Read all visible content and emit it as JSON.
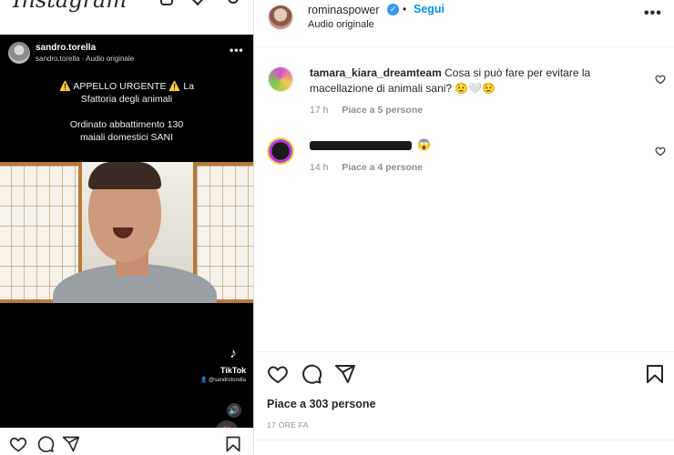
{
  "brand": {
    "name": "Instagram"
  },
  "video": {
    "username": "sandro.torella",
    "subline": "sandro.torella · Audio originale",
    "text_line1": "⚠️ APPELLO URGENTE ⚠️ La",
    "text_line2": "Sfattoria degli animali",
    "text_line3": "Ordinato abbattimento 130",
    "text_line4": "maiali domestici SANI",
    "tiktok_logo": "♪",
    "tiktok_label": "TikTok",
    "tiktok_handle": "👤 @sandrotorella",
    "more_icon": "•••",
    "sound_icon": "🔊",
    "mute_icon": "🔇"
  },
  "post": {
    "author": "rominaspower",
    "verified_mark": "✓",
    "separator": "•",
    "follow": "Segui",
    "audio": "Audio originale",
    "more_icon": "•••"
  },
  "comments": [
    {
      "username": "tamara_kiara_dreamteam",
      "text": "Cosa si può fare per evitare la macellazione di animali sani? 😟🤍😟",
      "time": "17 h",
      "likes": "Piace a 5 persone"
    },
    {
      "username": "",
      "text": "😱",
      "time": "14 h",
      "likes": "Piace a 4 persone"
    }
  ],
  "footer": {
    "likes": "Piace a 303 persone",
    "time_ago": "17 ORE FA"
  },
  "colors": {
    "accent": "#0095f6",
    "verified": "#3897f0",
    "secondary_text": "#8e8e8e"
  },
  "icons": {
    "heart": "heart-icon",
    "comment": "comment-icon",
    "share": "share-icon",
    "save": "bookmark-icon"
  }
}
